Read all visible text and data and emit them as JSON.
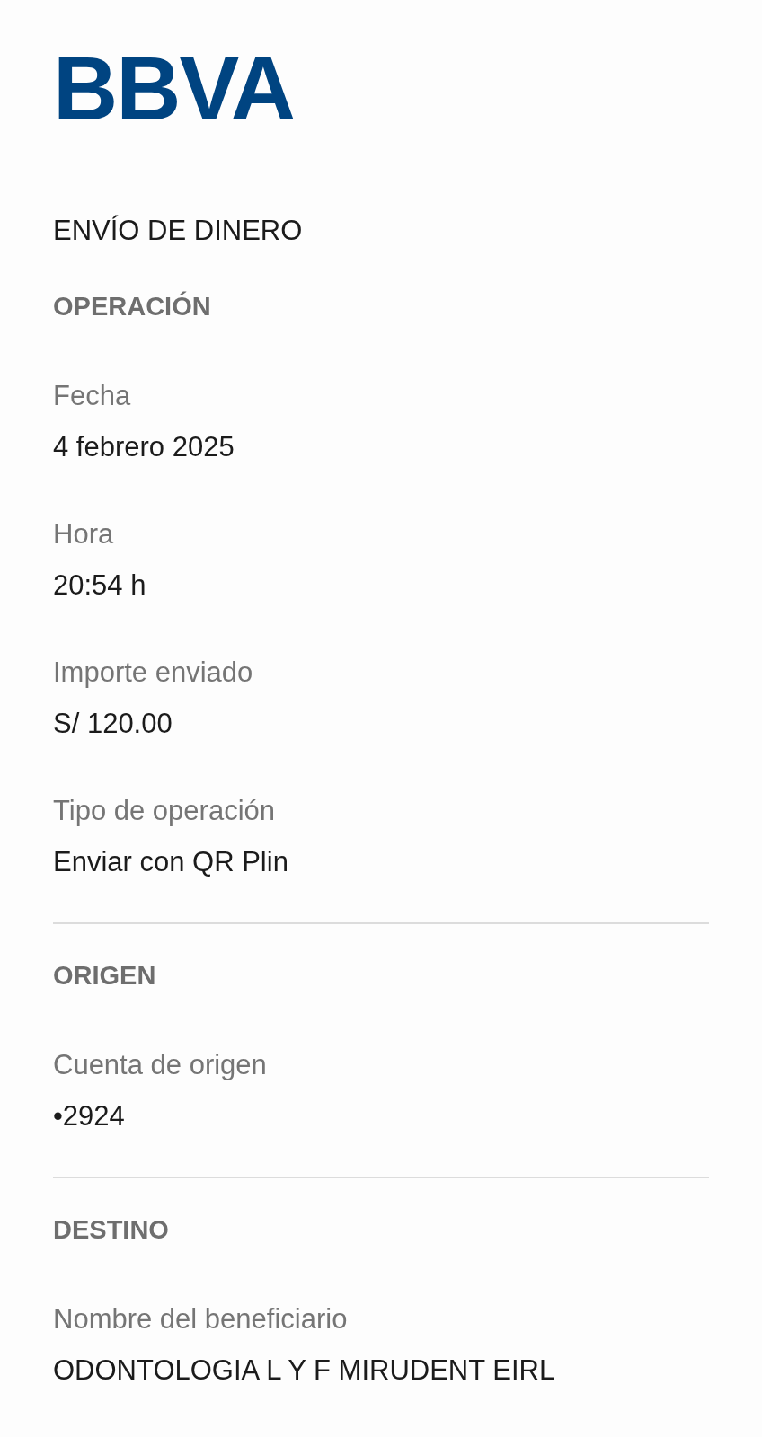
{
  "logo": {
    "text": "BBVA"
  },
  "title": "ENVÍO DE DINERO",
  "sections": [
    {
      "heading": "OPERACIÓN",
      "fields": [
        {
          "label": "Fecha",
          "value": "4 febrero 2025"
        },
        {
          "label": "Hora",
          "value": "20:54 h"
        },
        {
          "label": "Importe enviado",
          "value": "S/ 120.00"
        },
        {
          "label": "Tipo de operación",
          "value": "Enviar con QR Plin"
        }
      ]
    },
    {
      "heading": "ORIGEN",
      "fields": [
        {
          "label": "Cuenta de origen",
          "value": "•2924"
        }
      ]
    },
    {
      "heading": "DESTINO",
      "fields": [
        {
          "label": "Nombre del beneficiario",
          "value": "ODONTOLOGIA L Y F MIRUDENT EIRL"
        }
      ]
    }
  ]
}
